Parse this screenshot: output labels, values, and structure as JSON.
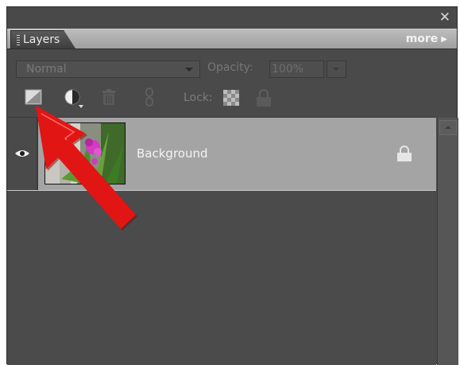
{
  "window": {
    "close_glyph": "✕"
  },
  "tab": {
    "label": "Layers"
  },
  "more": {
    "label": "more",
    "arrow": "▶"
  },
  "blend_mode": {
    "value": "Normal"
  },
  "opacity": {
    "label": "Opacity:",
    "value": "100%"
  },
  "lock": {
    "label": "Lock:"
  },
  "toolbar": {
    "icons": [
      "new-layer-icon",
      "adjustment-layer-icon",
      "trash-icon",
      "link-icon",
      "lock-transparency-icon",
      "lock-all-icon"
    ]
  },
  "layers": [
    {
      "name": "Background",
      "visible": true,
      "locked": true
    }
  ],
  "colors": {
    "annotation_arrow": "#e21515",
    "panel_bg": "#4a4a4a",
    "selected_row": "#a4a4a4"
  }
}
